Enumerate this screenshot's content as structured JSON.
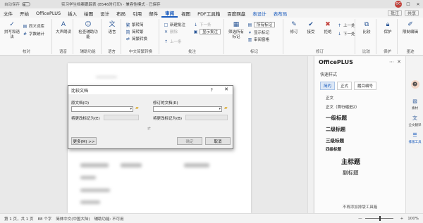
{
  "titlebar": {
    "autosave": "自动保存",
    "doc_title": "实习学生档案跟踪表 (8546时打印) · 兼容性模式 · 已保存",
    "avatar": "GC",
    "minimize": "—",
    "maximize": "☐",
    "close": "✕"
  },
  "menu": {
    "tabs": [
      "文件",
      "开始",
      "OfficePLUS",
      "插入",
      "绘图",
      "设计",
      "布局",
      "引用",
      "邮件",
      "审阅",
      "视图",
      "PDF工具箱",
      "百度网盘",
      "表设计",
      "表布局"
    ],
    "active": "审阅",
    "comment_label": "批注",
    "share_label": "共享"
  },
  "ribbon": {
    "proofing": {
      "spell": "拼写和语法",
      "thesaurus": "同义词库",
      "wordcount": "字数统计",
      "group": "校对"
    },
    "speech": {
      "read": "大声朗读",
      "group": "语音"
    },
    "access": {
      "check": "检查辅助功能",
      "group": "辅助功能"
    },
    "language": {
      "lang": "语言",
      "group": "语言"
    },
    "chinese": {
      "t2s": "繁转简",
      "s2t": "简转繁",
      "convert": "简繁转换",
      "group": "中文简繁转换"
    },
    "comments": {
      "new": "新建批注",
      "delete": "删除",
      "prev": "上一条",
      "next": "下一条",
      "show": "显示批注",
      "group": "批注"
    },
    "tracking": {
      "markup_dropdown": "所有标记",
      "show_markup": "显示标记",
      "pane": "审阅窗格",
      "filter": "筛选所有标记",
      "group": "标记"
    },
    "changes": {
      "track": "修订",
      "accept": "接受",
      "reject": "拒绝",
      "prev": "上一处",
      "next": "下一处",
      "group": "修订"
    },
    "compare": {
      "label": "比较",
      "group": "比较"
    },
    "protect": {
      "label": "保护",
      "group": "保护"
    },
    "restrict": {
      "label": "限制编辑",
      "group": "墨迹"
    }
  },
  "dialog": {
    "title": "比较文档",
    "help": "?",
    "close": "✕",
    "original_label": "原文档(O)",
    "revised_label": "修订的文档(R)",
    "original_mark": "将更改标记为(E)",
    "revised_mark": "将更改标记为(B)",
    "more": "更多(M) >>",
    "ok": "确定",
    "cancel": "取消",
    "swap": "⇄"
  },
  "panel": {
    "title": "OfficePLUS",
    "subtitle": "快速样式",
    "tabs": [
      "简约",
      "正式",
      "履目编号"
    ],
    "styles": [
      "正文",
      "正文（首行缩进2）",
      "一级标题",
      "二级标题",
      "三级标题",
      "四级标题",
      "主标题",
      "副标题"
    ],
    "footer": "不再添加排版工具箱",
    "menu": "⋯",
    "close": "✕"
  },
  "rail": {
    "items": [
      "",
      "素材",
      "全文翻译",
      "排版工具"
    ]
  },
  "statusbar": {
    "page": "第 1 页，共 1 页",
    "words": "88 个字",
    "lang": "简体中文(中国大陆)",
    "access": "辅助功能: 不可用",
    "zoom_pct": "100%",
    "zoom_minus": "—",
    "zoom_plus": "+"
  },
  "page": {
    "marker": "瑰"
  },
  "colors": {
    "accent": "#185abd",
    "dialog_bg": "#f0f0f0",
    "panel_bg": "#fbfbfb"
  }
}
